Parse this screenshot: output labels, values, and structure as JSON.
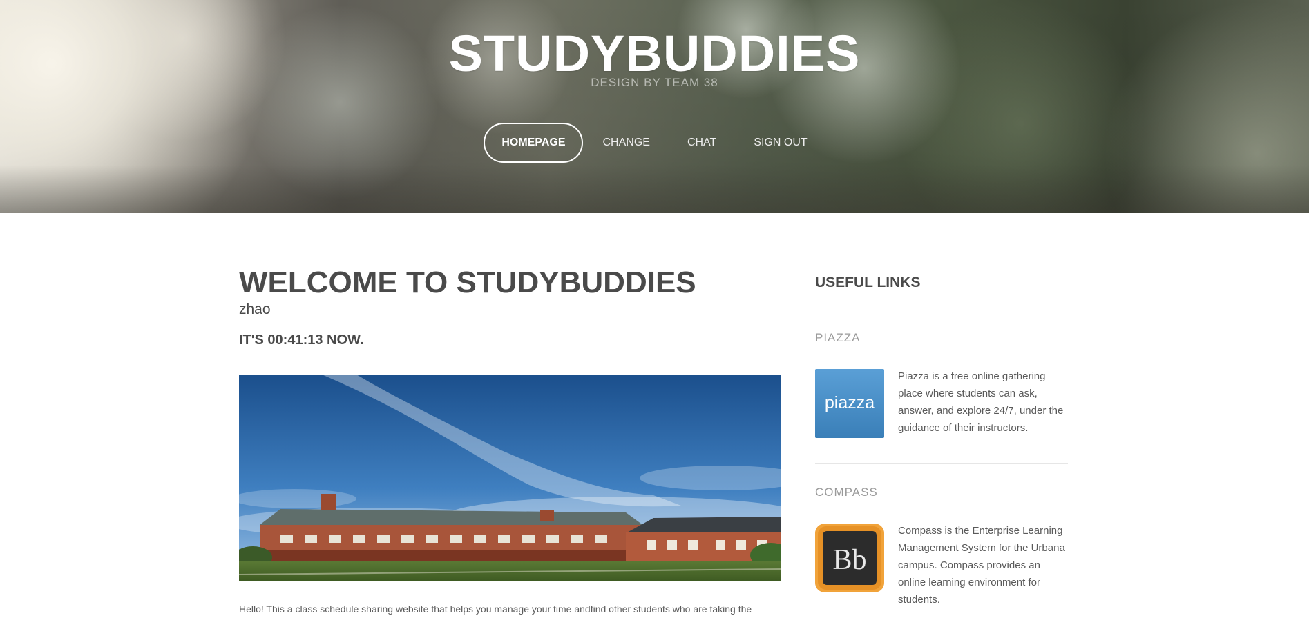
{
  "header": {
    "title": "STUDYBUDDIES",
    "subtitle": "DESIGN BY TEAM 38",
    "nav": [
      {
        "label": "HOMEPAGE",
        "active": true
      },
      {
        "label": "CHANGE",
        "active": false
      },
      {
        "label": "CHAT",
        "active": false
      },
      {
        "label": "SIGN OUT",
        "active": false
      }
    ]
  },
  "main": {
    "welcome_title": "WELCOME TO STUDYBUDDIES",
    "username": "zhao",
    "clock_text": "IT'S 00:41:13 NOW.",
    "intro_text": "Hello! This a class schedule sharing website that helps you manage your time andfind other students who are taking the"
  },
  "sidebar": {
    "title": "USEFUL LINKS",
    "links": [
      {
        "name": "PIAZZA",
        "logo_text": "piazza",
        "description": "Piazza is a free online gathering place where students can ask, answer, and explore 24/7, under the guidance of their instructors."
      },
      {
        "name": "COMPASS",
        "logo_text": "Bb",
        "description": "Compass is the Enterprise Learning Management System for the Urbana campus. Compass provides an online learning environment for students."
      }
    ]
  },
  "colors": {
    "heading": "#4a4a4a",
    "muted": "#9a9a9a",
    "body_text": "#5a5a5a",
    "piazza_blue": "#4a8ec6",
    "compass_orange": "#f1a33a"
  }
}
